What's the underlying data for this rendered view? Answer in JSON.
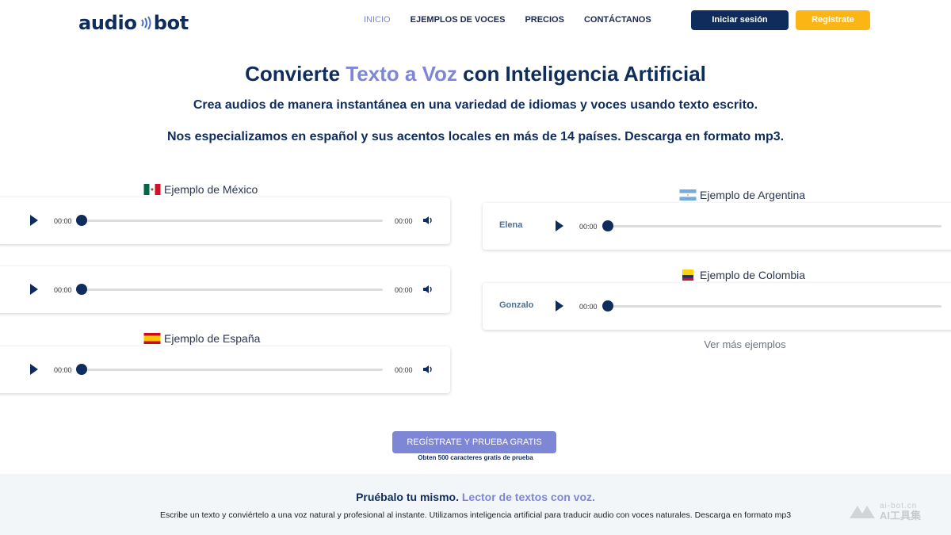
{
  "header": {
    "logo_left": "audio",
    "logo_right": "bot",
    "nav": [
      {
        "label": "INICIO",
        "active": true
      },
      {
        "label": "EJEMPLOS DE VOCES",
        "active": false
      },
      {
        "label": "PRECIOS",
        "active": false
      },
      {
        "label": "CONTÁCTANOS",
        "active": false
      }
    ],
    "login_label": "Iniciar sesión",
    "register_label": "Regístrate"
  },
  "hero": {
    "title_pre": "Convierte ",
    "title_highlight": "Texto a Voz",
    "title_post": " con Inteligencia Artificial",
    "subtitle1": "Crea audios de manera instantánea en una variedad de idiomas y voces usando texto escrito.",
    "subtitle2": "Nos especializamos en español y sus acentos locales en más de 14 países. Descarga en formato mp3."
  },
  "examples": {
    "mexico": {
      "label": "Ejemplo de México",
      "players": [
        {
          "current": "00:00",
          "duration": "00:00"
        },
        {
          "current": "00:00",
          "duration": "00:00"
        }
      ]
    },
    "espana": {
      "label": "Ejemplo de España",
      "players": [
        {
          "current": "00:00",
          "duration": "00:00"
        }
      ]
    },
    "argentina": {
      "label": "Ejemplo de Argentina",
      "players": [
        {
          "speaker": "Elena",
          "current": "00:00"
        }
      ]
    },
    "colombia": {
      "label": "Ejemplo de Colombia",
      "players": [
        {
          "speaker": "Gonzalo",
          "current": "00:00"
        }
      ]
    },
    "see_more": "Ver más ejemplos"
  },
  "cta": {
    "button": "REGÍSTRATE Y PRUEBA GRATIS",
    "note": "Obten 500 caracteres gratis de prueba"
  },
  "reader": {
    "title_pre": "Pruébalo tu mismo. ",
    "title_highlight": "Lector de textos con voz.",
    "description": "Escribe un texto y conviértelo a una voz natural y profesional al instante. Utilizamos inteligencia artificial para traducir audio con voces naturales. Descarga en formato mp3"
  },
  "watermark": {
    "top": "ai-bot.cn",
    "bottom": "AI工具集"
  },
  "colors": {
    "navy": "#0f2d5c",
    "accent": "#7e86d6",
    "yellow": "#fbb616",
    "band": "#f3f6f9"
  }
}
